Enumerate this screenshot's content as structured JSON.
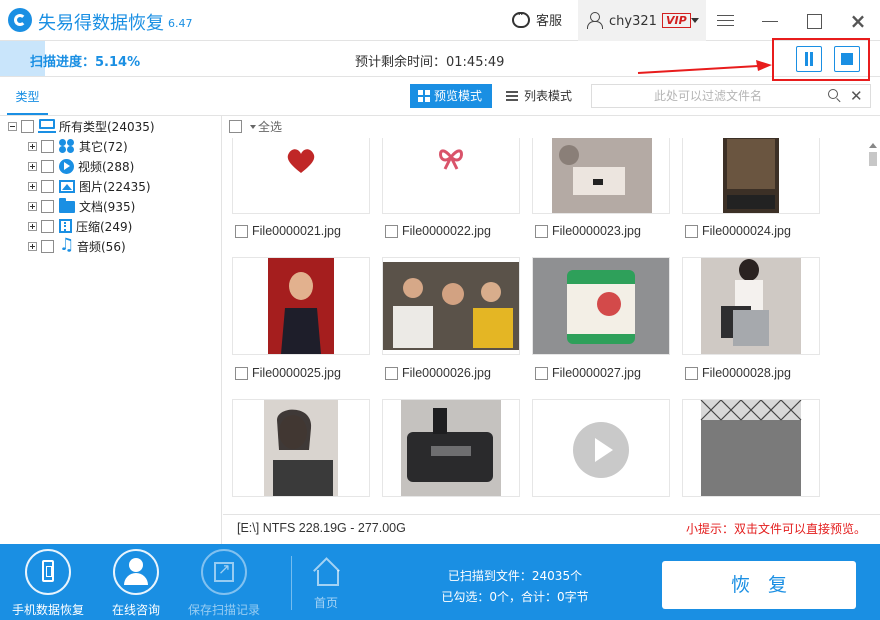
{
  "app": {
    "title": "失易得数据恢复",
    "version": "6.47"
  },
  "header": {
    "service_label": "客服",
    "username": "chy321",
    "vip_label": "VIP"
  },
  "progress": {
    "label": "扫描进度：5.14%",
    "value": 0.0514,
    "remaining": "预计剩余时间：01:45:49"
  },
  "toolbar": {
    "type_tab": "类型",
    "preview_mode": "预览模式",
    "list_mode": "列表模式",
    "filter_placeholder": "此处可以过滤文件名"
  },
  "tree": {
    "root": "所有类型(24035)",
    "items": [
      {
        "label": "其它(72)",
        "icon": "other-icon"
      },
      {
        "label": "视频(288)",
        "icon": "video-icon"
      },
      {
        "label": "图片(22435)",
        "icon": "image-icon"
      },
      {
        "label": "文档(935)",
        "icon": "document-icon"
      },
      {
        "label": "压缩(249)",
        "icon": "archive-icon"
      },
      {
        "label": "音频(56)",
        "icon": "audio-icon"
      }
    ]
  },
  "grid": {
    "select_all": "全选",
    "files": [
      {
        "name": "File0000021.jpg",
        "thumb": "heart-icon"
      },
      {
        "name": "File0000022.jpg",
        "thumb": "bow-icon"
      },
      {
        "name": "File0000023.jpg",
        "thumb": "photo"
      },
      {
        "name": "File0000024.jpg",
        "thumb": "photo"
      },
      {
        "name": "File0000025.jpg",
        "thumb": "photo"
      },
      {
        "name": "File0000026.jpg",
        "thumb": "photo"
      },
      {
        "name": "File0000027.jpg",
        "thumb": "photo"
      },
      {
        "name": "File0000028.jpg",
        "thumb": "photo"
      },
      {
        "name": "",
        "thumb": "photo"
      },
      {
        "name": "",
        "thumb": "photo"
      },
      {
        "name": "",
        "thumb": "play-icon"
      },
      {
        "name": "",
        "thumb": "photo"
      }
    ]
  },
  "status": {
    "disk": "[E:\\] NTFS 228.19G - 277.00G",
    "tip": "小提示：双击文件可以直接预览。"
  },
  "bottom": {
    "phone_recovery": "手机数据恢复",
    "online_support": "在线咨询",
    "save_scan": "保存扫描记录",
    "home": "首页",
    "scanned": "已扫描到文件：24035个",
    "selected": "已勾选：0个，合计：0字节",
    "recover": "恢复"
  },
  "colors": {
    "accent": "#1a8fe3",
    "alert": "#e81c1c"
  }
}
